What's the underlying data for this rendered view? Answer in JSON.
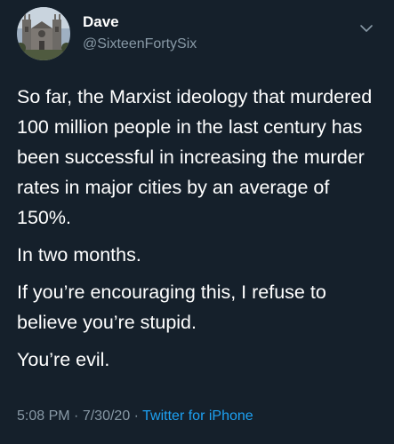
{
  "author": {
    "display_name": "Dave",
    "handle": "@SixteenFortySix",
    "avatar_icon": "cathedral-photo-avatar"
  },
  "menu": {
    "icon": "chevron-down-icon",
    "color": "#8899a6"
  },
  "tweet": {
    "paragraphs": [
      "So far, the Marxist ideology that murdered 100 million people in the last century has been successful in increasing the murder rates in major cities by an average of 150%.",
      "In two months.",
      "If you’re encouraging this, I refuse to believe you’re stupid.",
      "You’re evil."
    ]
  },
  "meta": {
    "time": "5:08 PM",
    "separator": "·",
    "date": "7/30/20",
    "source": "Twitter for iPhone"
  },
  "colors": {
    "background": "#15202b",
    "text": "#ffffff",
    "secondary_text": "#8899a6",
    "link": "#1da1f2"
  }
}
